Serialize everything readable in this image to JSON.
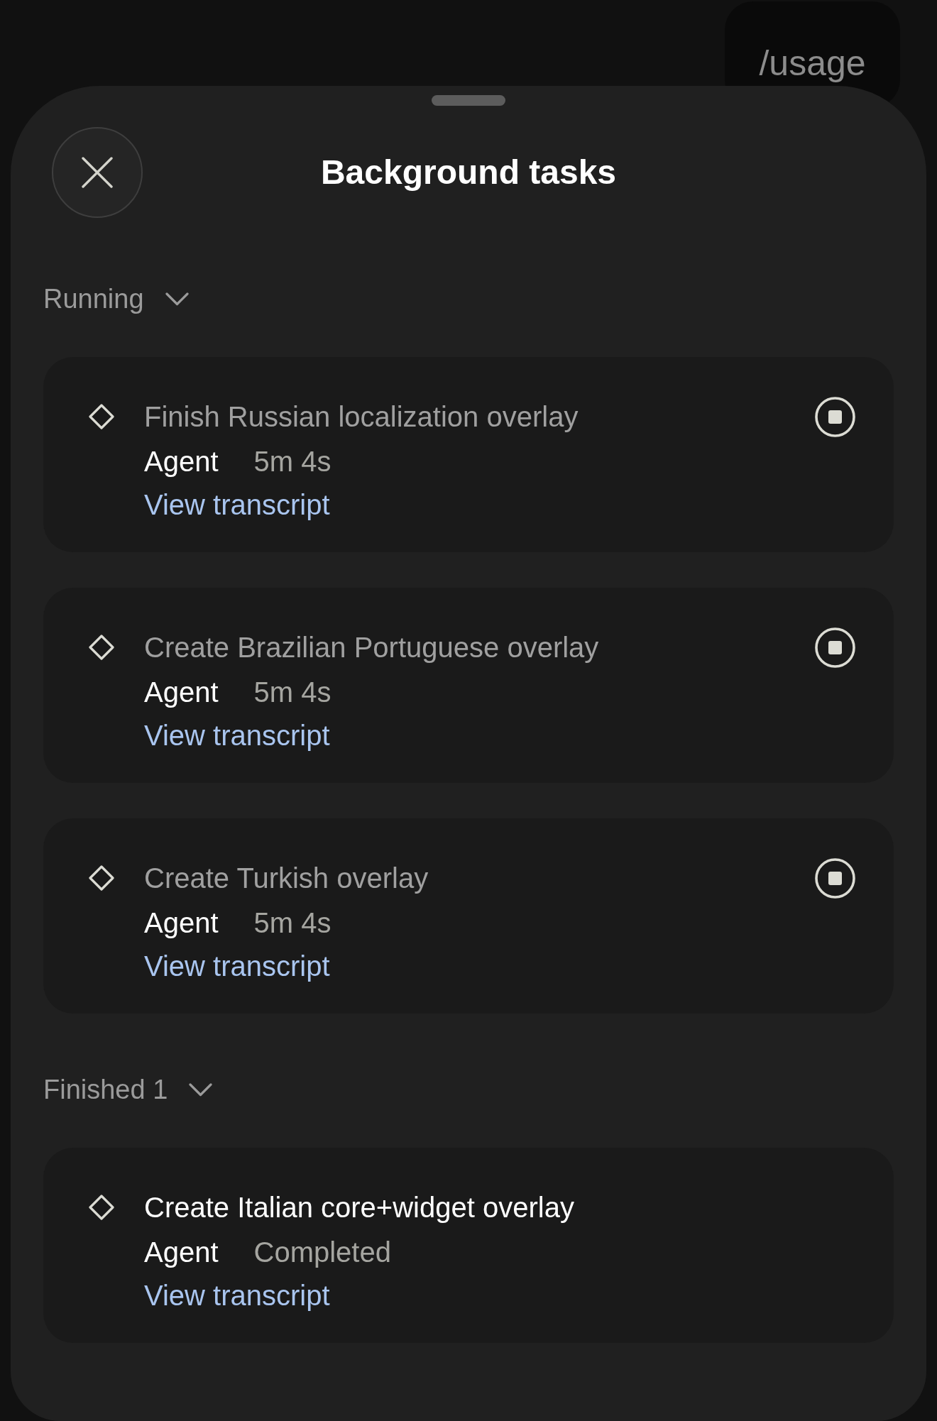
{
  "background": {
    "command_bubble": "/usage"
  },
  "sheet": {
    "title": "Background tasks",
    "sections": [
      {
        "label": "Running",
        "expanded": true,
        "tasks": [
          {
            "kind": "running",
            "title": "Finish Russian localization overlay",
            "agent": "Agent",
            "meta": "5m 4s",
            "link": "View transcript"
          },
          {
            "kind": "running",
            "title": "Create Brazilian Portuguese overlay",
            "agent": "Agent",
            "meta": "5m 4s",
            "link": "View transcript"
          },
          {
            "kind": "running",
            "title": "Create Turkish overlay",
            "agent": "Agent",
            "meta": "5m 4s",
            "link": "View transcript"
          }
        ]
      },
      {
        "label": "Finished",
        "count": "1",
        "expanded": true,
        "tasks": [
          {
            "kind": "finished",
            "title": "Create Italian core+widget overlay",
            "agent": "Agent",
            "meta": "Completed",
            "link": "View transcript"
          }
        ]
      }
    ]
  }
}
